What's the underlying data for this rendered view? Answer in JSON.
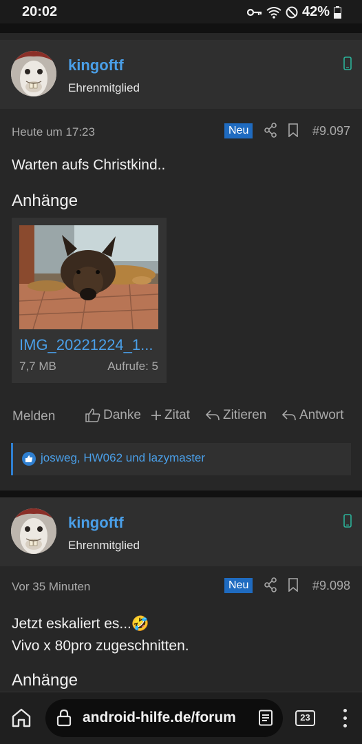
{
  "status_bar": {
    "time": "20:02",
    "battery": "42%"
  },
  "posts": [
    {
      "username": "kingoftf",
      "user_title": "Ehrenmitglied",
      "timestamp": "Heute um 17:23",
      "badge": "Neu",
      "post_number": "#9.097",
      "message": [
        "Warten aufs Christkind.."
      ],
      "attachments_heading": "Anhänge",
      "attachment": {
        "name": "IMG_20221224_1...",
        "size": "7,7 MB",
        "views": "Aufrufe: 5"
      },
      "actions": {
        "report": "Melden",
        "thanks": "Danke",
        "quote_add": "Zitat",
        "quote": "Zitieren",
        "reply": "Antwort"
      },
      "reactions": "josweg, HW062 und lazymaster"
    },
    {
      "username": "kingoftf",
      "user_title": "Ehrenmitglied",
      "timestamp": "Vor 35 Minuten",
      "badge": "Neu",
      "post_number": "#9.098",
      "message": [
        "Jetzt eskaliert es...🤣",
        "Vivo x 80pro zugeschnitten."
      ],
      "attachments_heading": "Anhänge"
    }
  ],
  "browser": {
    "url": "android-hilfe.de/forum",
    "tab_count": "23"
  },
  "colors": {
    "link": "#4a9fe8",
    "badge": "#1f6bc0",
    "background": "#1b1b1b"
  }
}
